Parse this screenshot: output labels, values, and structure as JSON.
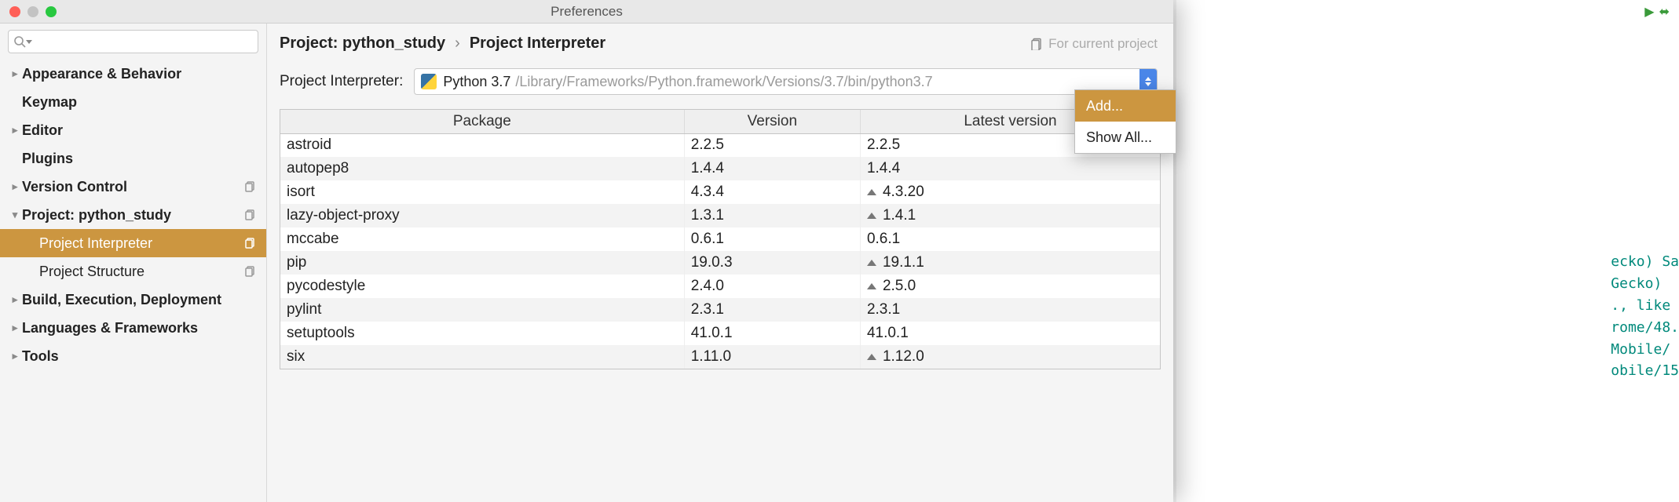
{
  "window": {
    "title": "Preferences"
  },
  "sidebar": {
    "search_placeholder": "",
    "items": [
      {
        "label": "Appearance & Behavior",
        "bold": true,
        "disclose": "right"
      },
      {
        "label": "Keymap",
        "bold": true
      },
      {
        "label": "Editor",
        "bold": true,
        "disclose": "right"
      },
      {
        "label": "Plugins",
        "bold": true
      },
      {
        "label": "Version Control",
        "bold": true,
        "disclose": "right",
        "copy": true
      },
      {
        "label": "Project: python_study",
        "bold": true,
        "disclose": "down",
        "copy": true
      },
      {
        "label": "Project Interpreter",
        "child": true,
        "copy": true,
        "selected": true
      },
      {
        "label": "Project Structure",
        "child": true,
        "copy": true
      },
      {
        "label": "Build, Execution, Deployment",
        "bold": true,
        "disclose": "right"
      },
      {
        "label": "Languages & Frameworks",
        "bold": true,
        "disclose": "right"
      },
      {
        "label": "Tools",
        "bold": true,
        "disclose": "right"
      }
    ]
  },
  "breadcrumb": {
    "project": "Project: python_study",
    "sep": "›",
    "page": "Project Interpreter",
    "for_current": "For current project"
  },
  "interpreter": {
    "label": "Project Interpreter:",
    "name": "Python 3.7",
    "path": "/Library/Frameworks/Python.framework/Versions/3.7/bin/python3.7"
  },
  "popup": {
    "items": [
      {
        "label": "Add...",
        "selected": true
      },
      {
        "label": "Show All..."
      }
    ]
  },
  "table": {
    "headers": [
      "Package",
      "Version",
      "Latest version"
    ],
    "rows": [
      {
        "pkg": "astroid",
        "ver": "2.2.5",
        "latest": "2.2.5",
        "upgrade": false
      },
      {
        "pkg": "autopep8",
        "ver": "1.4.4",
        "latest": "1.4.4",
        "upgrade": false
      },
      {
        "pkg": "isort",
        "ver": "4.3.4",
        "latest": "4.3.20",
        "upgrade": true
      },
      {
        "pkg": "lazy-object-proxy",
        "ver": "1.3.1",
        "latest": "1.4.1",
        "upgrade": true
      },
      {
        "pkg": "mccabe",
        "ver": "0.6.1",
        "latest": "0.6.1",
        "upgrade": false
      },
      {
        "pkg": "pip",
        "ver": "19.0.3",
        "latest": "19.1.1",
        "upgrade": true
      },
      {
        "pkg": "pycodestyle",
        "ver": "2.4.0",
        "latest": "2.5.0",
        "upgrade": true
      },
      {
        "pkg": "pylint",
        "ver": "2.3.1",
        "latest": "2.3.1",
        "upgrade": false
      },
      {
        "pkg": "setuptools",
        "ver": "41.0.1",
        "latest": "41.0.1",
        "upgrade": false
      },
      {
        "pkg": "six",
        "ver": "1.11.0",
        "latest": "1.12.0",
        "upgrade": true
      }
    ]
  },
  "bg_code": "ecko) Sa\nGecko)\n., like\nrome/48.\nMobile/\nobile/15"
}
